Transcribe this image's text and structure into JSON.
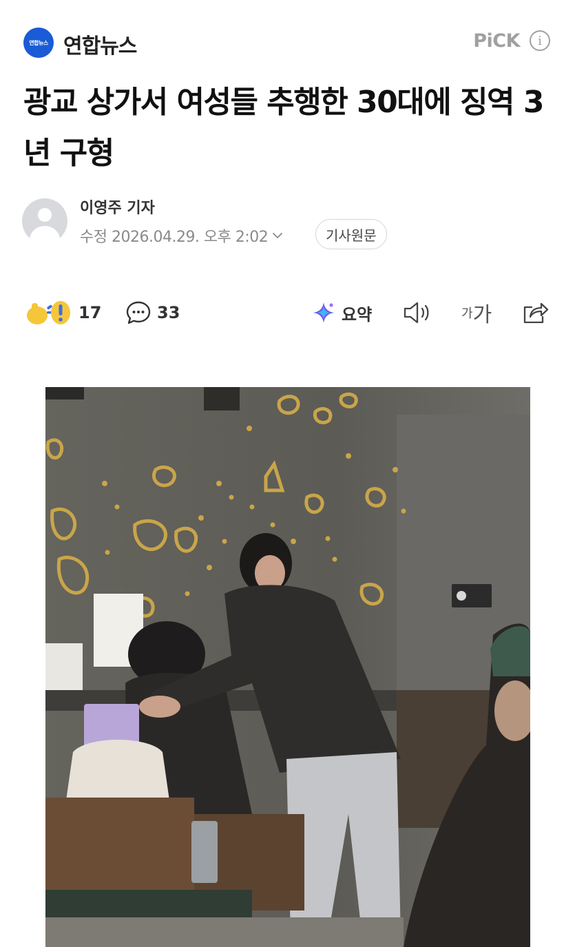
{
  "header": {
    "press_logo_text": "연합뉴스",
    "press_name": "연합뉴스",
    "pick_label": "PiCK",
    "info_icon": "info-icon"
  },
  "article": {
    "headline": "광교 상가서 여성들 추행한 30대에 징역 3년 구형",
    "reporter": "이영주 기자",
    "date_text": "수정 2026.04.29. 오후 2:02",
    "original_button": "기사원문"
  },
  "actions": {
    "reaction_count": "17",
    "comment_count": "33",
    "summary_label": "요약",
    "font_small": "가",
    "font_large": "가"
  },
  "icons": {
    "reaction": "reaction-emoji-icon",
    "comment": "comment-bubble-icon",
    "summary": "ai-summary-sparkle-icon",
    "audio": "speaker-icon",
    "font_size": "font-size-icon",
    "share": "share-icon",
    "date_toggle": "chevron-down-icon"
  },
  "colors": {
    "logo_blue": "#1a5bd6",
    "pick_gray": "#a0a0a0",
    "text_primary": "#111111",
    "text_secondary": "#8a8a8a"
  }
}
